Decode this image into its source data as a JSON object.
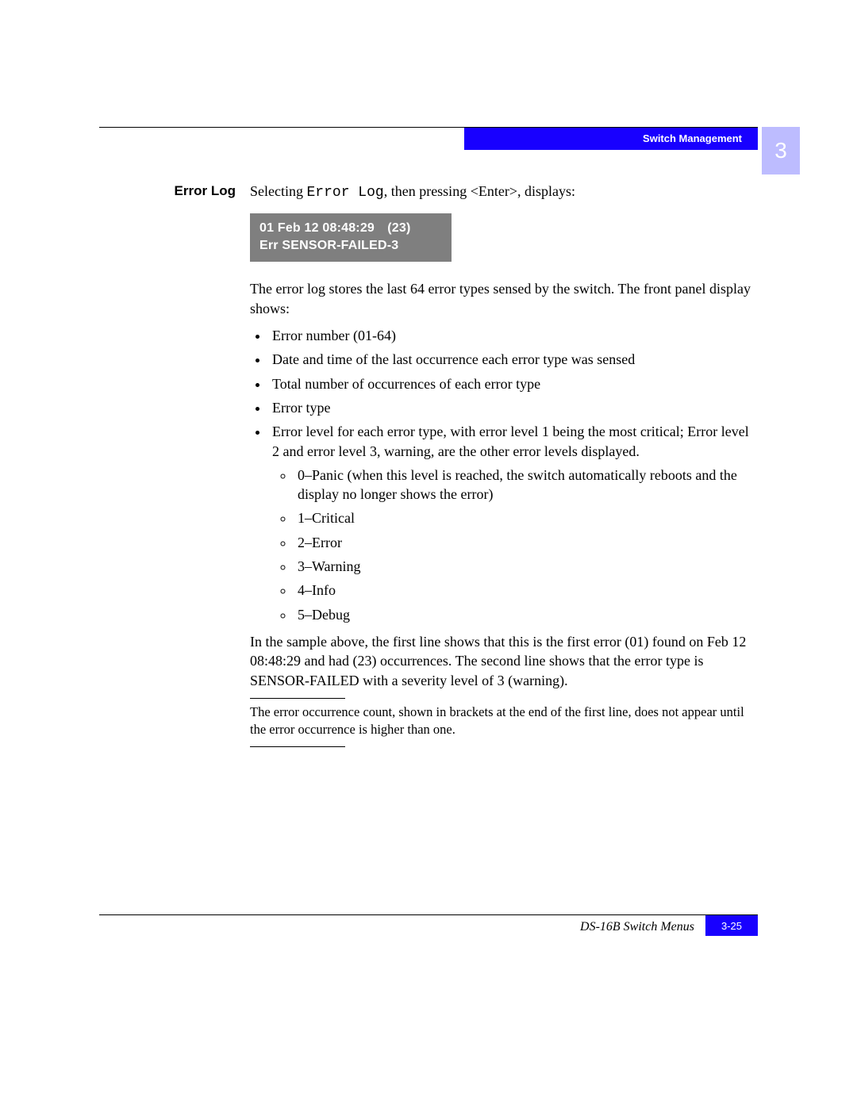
{
  "header": {
    "section_title": "Switch Management",
    "chapter_number": "3"
  },
  "side_heading": "Error Log",
  "intro": {
    "pre": "Selecting ",
    "code": "Error Log",
    "post": ", then pressing <Enter>, displays:"
  },
  "display_panel": {
    "line1": "01 Feb 12 08:48:29 (23)",
    "line2": "Err SENSOR-FAILED-3"
  },
  "para1": "The error log stores the last 64 error types sensed by the switch. The front panel display shows:",
  "bullets": [
    "Error number (01-64)",
    "Date and time of the last occurrence each error type was sensed",
    "Total number of occurrences of each error type",
    "Error type",
    "Error level for each error type, with error level 1 being the most critical; Error level 2 and error level 3, warning, are the other error levels displayed."
  ],
  "sub_bullets": [
    "0–Panic (when this level is reached, the switch automatically reboots and the display no longer shows the error)",
    "1–Critical",
    "2–Error",
    "3–Warning",
    "4–Info",
    "5–Debug"
  ],
  "para2": "In the sample above, the first line shows that this is the first error (01) found on Feb 12 08:48:29 and had (23) occurrences. The second line shows that the error type is SENSOR-FAILED with a severity level of 3 (warning).",
  "note": "The error occurrence count, shown in brackets at the end of the first line, does not appear until the error occurrence is higher than one.",
  "footer": {
    "title": "DS-16B Switch Menus",
    "page": "3-25"
  }
}
